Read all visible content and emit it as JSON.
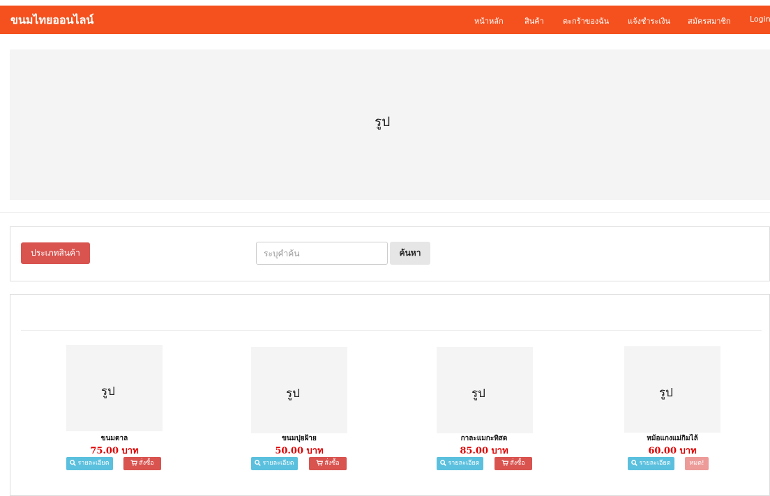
{
  "navbar": {
    "brand": "ขนมไทยออนไลน์",
    "items": [
      {
        "label": "หน้าหลัก"
      },
      {
        "label": "สินค้า"
      },
      {
        "label": "ตะกร้าของฉัน"
      },
      {
        "label": "แจ้งชำระเงิน"
      },
      {
        "label": "สมัครสมาชิก"
      },
      {
        "label": "Login"
      }
    ]
  },
  "banner": {
    "image_text": "รูป"
  },
  "filter": {
    "category_button": "ประเภทสินค้า",
    "search_placeholder": "ระบุคำค้น",
    "search_value": "",
    "search_button": "ค้นหา"
  },
  "products": [
    {
      "image_text": "รูป",
      "name": "ขนมตาล",
      "price": "75.00 บาท",
      "detail_label": "รายละเอียด",
      "action_label": "สั่งซื้อ",
      "in_stock": true
    },
    {
      "image_text": "รูป",
      "name": "ขนมปุยฝ้าย",
      "price": "50.00 บาท",
      "detail_label": "รายละเอียด",
      "action_label": "สั่งซื้อ",
      "in_stock": true
    },
    {
      "image_text": "รูป",
      "name": "กาละแมกะทิสด",
      "price": "85.00 บาท",
      "detail_label": "รายละเอียด",
      "action_label": "สั่งซื้อ",
      "in_stock": true
    },
    {
      "image_text": "รูป",
      "name": "หม้อแกงแม่กิมไล้",
      "price": "60.00 บาท",
      "detail_label": "รายละเอียด",
      "action_label": "หมด!",
      "in_stock": false
    }
  ],
  "colors": {
    "navbar": "#f4511e",
    "danger": "#d9534f",
    "info": "#5bc0de",
    "price": "#e00000",
    "placeholder_bg": "#f4f4f4"
  },
  "icons": {
    "detail": "search-icon",
    "order": "cart-icon"
  }
}
